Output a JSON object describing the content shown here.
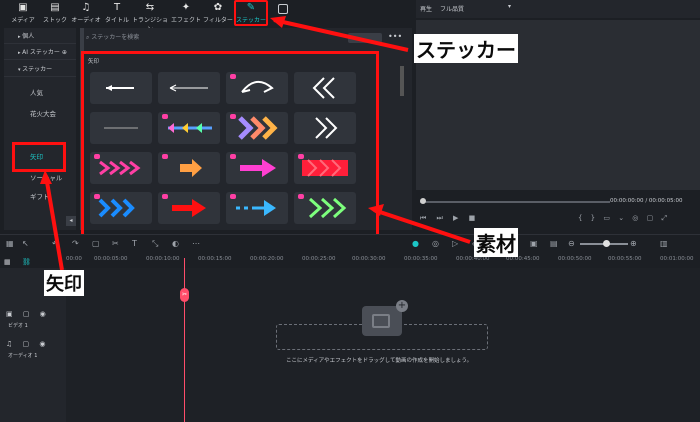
{
  "tabs": [
    {
      "label": "メディア",
      "icon": "media-icon"
    },
    {
      "label": "ストック",
      "icon": "stock-icon"
    },
    {
      "label": "オーディオ",
      "icon": "music-icon"
    },
    {
      "label": "タイトル",
      "icon": "title-icon"
    },
    {
      "label": "トランジション",
      "icon": "transition-icon"
    },
    {
      "label": "エフェクト",
      "icon": "effect-icon"
    },
    {
      "label": "フィルター",
      "icon": "filter-icon"
    },
    {
      "label": "ステッカー",
      "icon": "sticker-icon",
      "active": true
    }
  ],
  "sidebar": {
    "items": [
      {
        "label": "個人"
      },
      {
        "label": "AI ステッカー"
      },
      {
        "label": "ステッカー"
      }
    ],
    "sub_items": [
      "人気",
      "花火大会",
      "矢印",
      "ギフト"
    ],
    "sub_item_partial": "ソーシャル"
  },
  "search": {
    "placeholder": "ステッカーを検索"
  },
  "section": {
    "title": "矢印"
  },
  "preview": {
    "label": "再生",
    "quality": "フル品質",
    "time_current": "00:00:00:00",
    "time_sep": "/",
    "time_total": "00:00:05:00"
  },
  "ruler": [
    "00:00",
    "00:00:05:00",
    "00:00:10:00",
    "00:00:15:00",
    "00:00:20:00",
    "00:00:25:00",
    "00:00:30:00",
    "00:00:35:00",
    "00:00:40:00",
    "00:00:45:00",
    "00:00:50:00",
    "00:00:55:00",
    "00:01:00:00"
  ],
  "tracks": {
    "video": "ビデオ 1",
    "audio": "オーディオ 1"
  },
  "timeline": {
    "hint": "ここにメディアやエフェクトをドラッグして動画の作成を開始しましょう。"
  },
  "annotations": {
    "sticker": "ステッカー",
    "material": "素材",
    "arrow": "矢印"
  },
  "colors": {
    "accent": "#1cc6c6",
    "highlight": "#ff1010",
    "playhead": "#ff4d6a"
  }
}
